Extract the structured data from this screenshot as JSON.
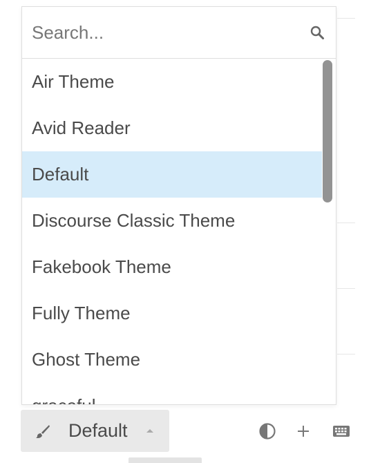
{
  "search": {
    "placeholder": "Search..."
  },
  "themes": {
    "items": [
      "Air Theme",
      "Avid Reader",
      "Default",
      "Discourse Classic Theme",
      "Fakebook Theme",
      "Fully Theme",
      "Ghost Theme",
      "graceful"
    ],
    "selected": "Default"
  },
  "footer": {
    "theme_label": "Default"
  },
  "icons": {
    "search": "search-icon",
    "brush": "brush-icon",
    "caret": "caret-up-icon",
    "contrast": "contrast-icon",
    "plus": "plus-icon",
    "keyboard": "keyboard-icon"
  },
  "colors": {
    "selected_row": "#d6ecfa",
    "text": "#4a4a4a",
    "button_bg": "#e9e9e9",
    "scrollbar": "#939393"
  }
}
